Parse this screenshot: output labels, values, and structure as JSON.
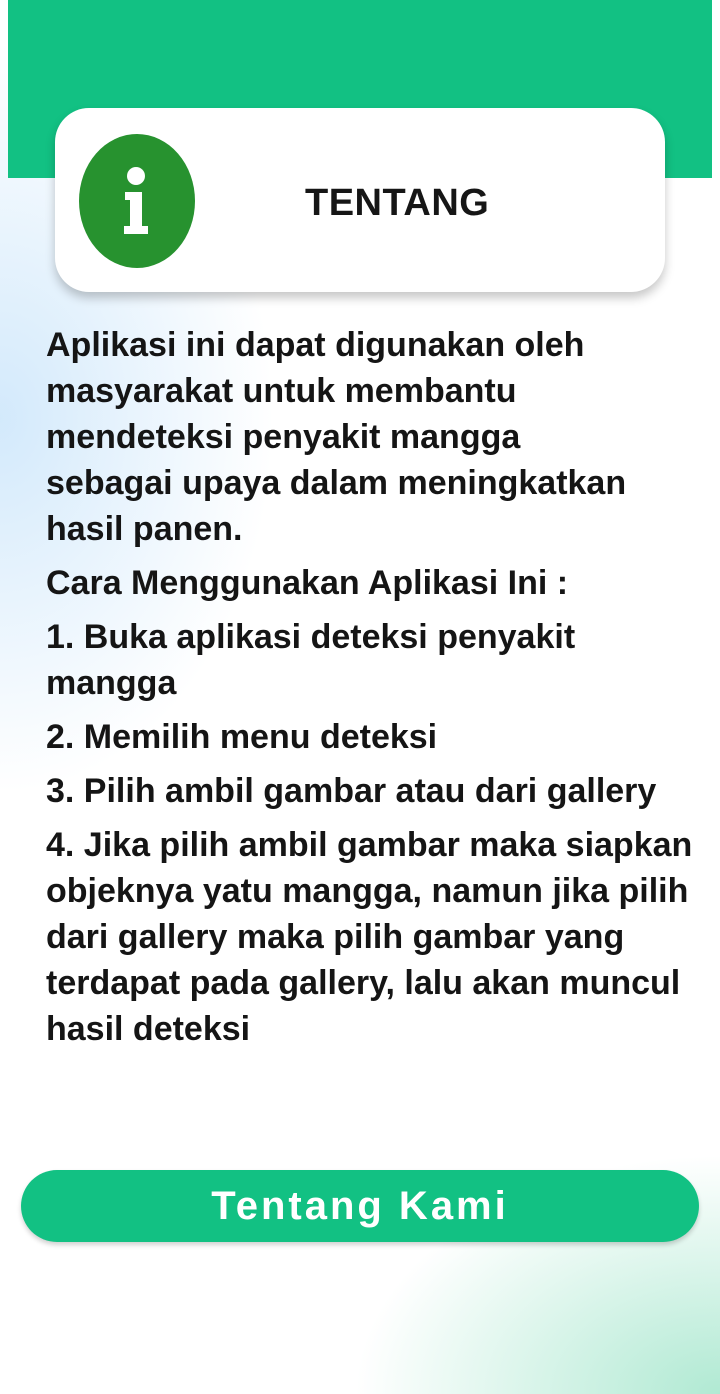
{
  "header": {
    "title": "TENTANG",
    "icon": "info-icon"
  },
  "colors": {
    "accent": "#12c183",
    "icon_circle": "#27922f",
    "text": "#151515"
  },
  "content": {
    "intro": "Aplikasi ini dapat digunakan oleh masyarakat untuk membantu mendeteksi penyakit mangga sebagai upaya dalam meningkatkan hasil panen.",
    "howto_heading": "Cara Menggunakan Aplikasi Ini :",
    "steps": [
      "1. Buka aplikasi deteksi penyakit mangga",
      "2. Memilih menu deteksi",
      "3. Pilih ambil gambar atau dari gallery",
      "4. Jika pilih ambil gambar maka siapkan  objeknya yatu mangga, namun jika pilih dari gallery maka pilih gambar yang terdapat pada gallery, lalu akan muncul hasil deteksi"
    ]
  },
  "footer": {
    "about_button_label": "Tentang Kami"
  }
}
